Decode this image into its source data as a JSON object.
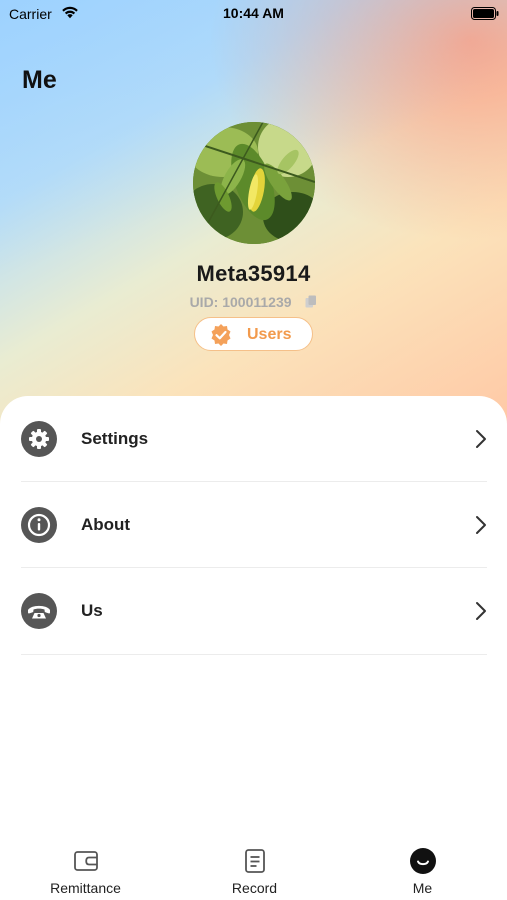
{
  "status_bar": {
    "carrier": "Carrier",
    "time": "10:44 AM"
  },
  "header": {
    "title": "Me"
  },
  "profile": {
    "username": "Meta35914",
    "uid": "UID: 100011239",
    "badge_label": "Users",
    "badge_color": "#f29a4c"
  },
  "menu": {
    "items": [
      {
        "label": "Settings",
        "icon": "gear-icon"
      },
      {
        "label": "About",
        "icon": "info-icon"
      },
      {
        "label": "Us",
        "icon": "phone-icon"
      }
    ]
  },
  "tab_bar": {
    "tabs": [
      {
        "label": "Remittance",
        "icon": "wallet-icon",
        "active": false
      },
      {
        "label": "Record",
        "icon": "document-icon",
        "active": false
      },
      {
        "label": "Me",
        "icon": "smiley-icon",
        "active": true
      }
    ]
  },
  "colors": {
    "accent": "#f29a4c",
    "menu_icon_bg": "#565656"
  }
}
